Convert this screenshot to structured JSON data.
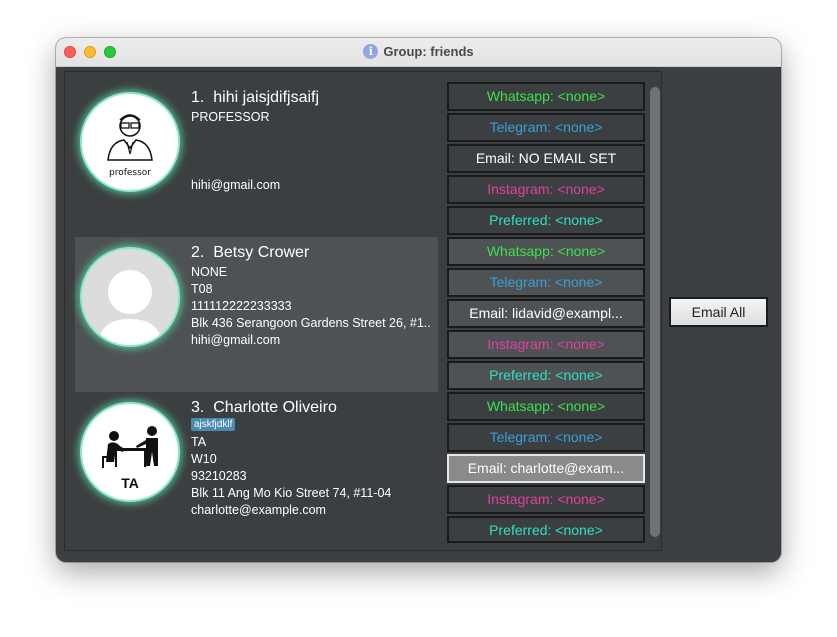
{
  "window": {
    "title": "Group: friends"
  },
  "colors": {
    "whatsapp": "#3fe04a",
    "telegram": "#3a9fd8",
    "email": "#ffffff",
    "instagram": "#e040a0",
    "preferred": "#2fe0c0"
  },
  "contacts": [
    {
      "index": "1.",
      "name": "hihi jaisjdifjsaifj",
      "lines": [
        "PROFESSOR",
        "hihi@gmail.com"
      ],
      "avatar_label": "professor",
      "channels": [
        "Whatsapp: <none>",
        "Telegram: <none>",
        "Email: NO EMAIL SET",
        "Instagram: <none>",
        "Preferred: <none>"
      ]
    },
    {
      "index": "2.",
      "name": "Betsy Crower",
      "lines": [
        "NONE",
        "T08",
        "111112222233333",
        "Blk 436 Serangoon Gardens Street 26, #1...",
        "hihi@gmail.com"
      ],
      "channels": [
        "Whatsapp: <none>",
        "Telegram: <none>",
        "Email: lidavid@exampl...",
        "Instagram: <none>",
        "Preferred: <none>"
      ]
    },
    {
      "index": "3.",
      "name": "Charlotte Oliveiro",
      "tag": "ajskfjdklf",
      "lines": [
        "TA",
        "W10",
        "93210283",
        "Blk 11 Ang Mo Kio Street 74, #11-04",
        "charlotte@example.com"
      ],
      "avatar_label": "TA",
      "channels": [
        "Whatsapp: <none>",
        "Telegram: <none>",
        "Email: charlotte@exam...",
        "Instagram: <none>",
        "Preferred: <none>"
      ]
    }
  ],
  "actions": {
    "email_all": "Email All"
  }
}
